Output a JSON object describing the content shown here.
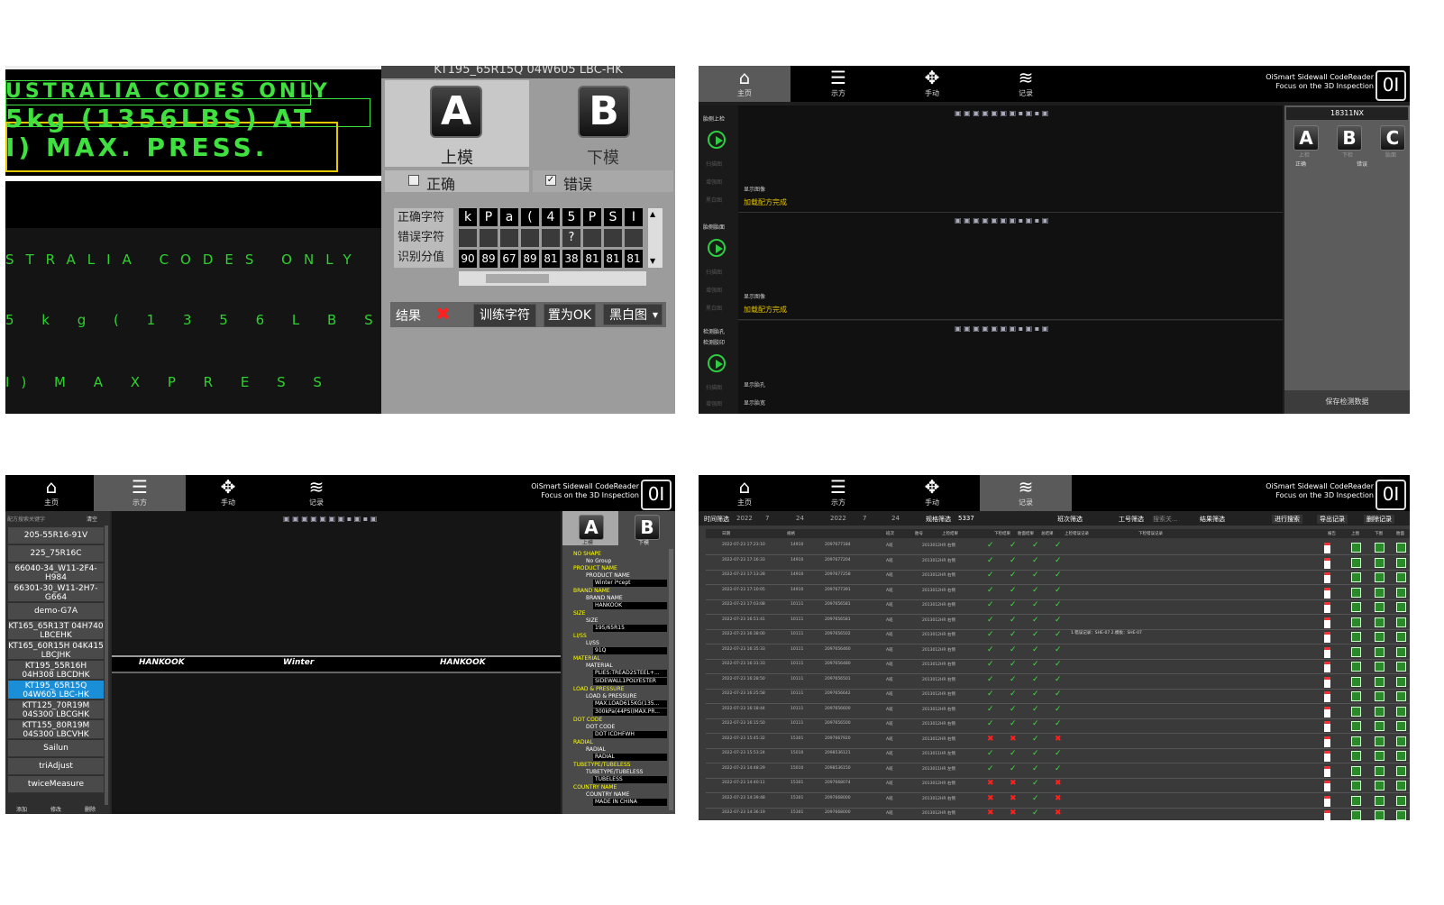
{
  "panel1": {
    "ocr_top_lines": [
      "USTRALIA CODES ONLY",
      "5kg (1356LBS) AT",
      "I) MAX. PRESS."
    ],
    "ocr_spaced_lines": [
      "STRALIA CODES ONLY",
      "5 k g ( 1 3 5 6 L B S ) A T",
      "I) M A X P R E S S"
    ],
    "mold_title": "KT195_65R15Q 04W605 LBC-HK",
    "upper_mold_key": "A",
    "upper_mold_label": "上模",
    "lower_mold_key": "B",
    "lower_mold_label": "下模",
    "correct_label": "正确",
    "wrong_label": "错误",
    "correct_checked": false,
    "wrong_checked": true,
    "row_correct_chars": "正确字符",
    "row_wrong_chars": "错误字符",
    "row_scores": "识别分值",
    "chars": [
      "k",
      "P",
      "a",
      "(",
      "4",
      "5",
      "P",
      "S",
      "I"
    ],
    "wrong_chars": [
      "",
      "",
      "",
      "",
      "",
      "?",
      "",
      "",
      ""
    ],
    "scores": [
      "90",
      "89",
      "67",
      "89",
      "81",
      "38",
      "81",
      "81",
      "81"
    ],
    "result_label": "结果",
    "result_icon": "x-icon",
    "train_button": "训练字符",
    "set_ok_button": "置为OK",
    "view_select": "黑白图"
  },
  "nav": {
    "home": "主页",
    "teach": "示方",
    "manual": "手动",
    "record": "记录"
  },
  "brand": {
    "name": "OiSmart Sidewall CodeReader",
    "slogan": "Focus on the 3D Inspection",
    "logo": "0I"
  },
  "panel2": {
    "side_labels_1": [
      "胎侧上检",
      "扫描图",
      "增强图",
      "黑白图"
    ],
    "side_labels_2": [
      "胎侧胎面",
      "扫描图",
      "增强图",
      "黑白图"
    ],
    "side_labels_3": [
      "检测胎孔",
      "检测胶印",
      "扫描图",
      "增强图"
    ],
    "show_img_labels": [
      "显示图像",
      "显示图像",
      "显示胎孔",
      "显示胎宽"
    ],
    "load_done": [
      "加载配方完成",
      "加载配方完成"
    ],
    "recipe_id": "18311NX",
    "keys": [
      "A",
      "B",
      "C"
    ],
    "key_labels": [
      "上检",
      "下检",
      "胎面"
    ],
    "right_checks": [
      "正确",
      "错误"
    ],
    "save_button": "保存检测数据"
  },
  "panel3": {
    "search_placeholder": "配方搜索关键字",
    "clear_label": "清空",
    "recipes": [
      "205-55R16-91V",
      "225_75R16C",
      "66040-34_W11-2F4-H984",
      "66301-30_W11-2H7-G664",
      "demo-G7A",
      "KT165_65R13T 04H740 LBCEHK",
      "KT165_60R15H 04K415 LBCJHK",
      "KT195_55R16H 04H308 LBCDHK",
      "KT195_65R15Q 04W605 LBC-HK",
      "KTT125_70R19M 04S300 LBCGHK",
      "KTT155_80R19M 04S300 LBCVHK",
      "Sailun",
      "triAdjust",
      "twiceMeasure"
    ],
    "selected_index": 8,
    "bottom_buttons": [
      "添加",
      "修改",
      "删除"
    ],
    "tread_texts": [
      "HANKOOK",
      "Winter",
      "HANKOOK"
    ],
    "keys": [
      "A",
      "B"
    ],
    "key_labels": [
      "上模",
      "下模"
    ],
    "tree": [
      {
        "group": "NO SHAPE",
        "item": "No Group",
        "value": ""
      },
      {
        "group": "PRODUCT NAME",
        "item": "PRODUCT NAME",
        "value": "Winter i*cept"
      },
      {
        "group": "BRAND NAME",
        "item": "BRAND NAME",
        "value": "HANKOOK"
      },
      {
        "group": "SIZE",
        "item": "SIZE",
        "value": "195/65R15"
      },
      {
        "group": "LI/SS",
        "item": "LI/SS",
        "value": "91Q"
      },
      {
        "group": "MATERIAL",
        "item": "MATERIAL",
        "value": "PLIES:TREAD2STEEL+..."
      },
      {
        "group": "",
        "item": "",
        "value": "SIDEWALL1POLYESTER"
      },
      {
        "group": "LOAD & PRESSURE",
        "item": "LOAD & PRESSURE",
        "value": "MAX.LOAD615KG(135..."
      },
      {
        "group": "",
        "item": "",
        "value": "300kPa(44PSI)MAX.PR..."
      },
      {
        "group": "DOT CODE",
        "item": "DOT CODE",
        "value": "DOT ICDHFWH"
      },
      {
        "group": "RADIAL",
        "item": "RADIAL",
        "value": "RADIAL"
      },
      {
        "group": "TUBETYPE/TUBELESS",
        "item": "TUBETYPE/TUBELESS",
        "value": "TUBELESS"
      },
      {
        "group": "COUNTRY NAME",
        "item": "COUNTRY NAME",
        "value": "MADE IN CHINA"
      }
    ]
  },
  "panel4": {
    "time_filter": "时间筛选",
    "date_from": "2022",
    "date_to": "2022",
    "month_from": "7",
    "day_from": "24",
    "month_to": "7",
    "day_to": "24",
    "spec_filter": "规格筛选",
    "spec_value": "5337",
    "shift_filter": "班次筛选",
    "worker_filter": "工号筛选",
    "worker_placeholder": "搜索关...",
    "result_filter": "结果筛选",
    "search_button": "进行搜索",
    "export_button": "导出记录",
    "delete_button": "删除记录",
    "columns": [
      "日期",
      "规格",
      "班次",
      "胎号",
      "上检结果",
      "下检结果",
      "胎面结果",
      "总结果",
      "上检错误记录",
      "下检错误记录",
      "报告",
      "上图",
      "下图",
      "胎面"
    ],
    "rows": [
      {
        "date": "2022-07-23 17:23:10",
        "spec": "14910",
        "no": "2097677184",
        "shift": "A班",
        "code": "2013012HR 右侧",
        "r": [
          "ok",
          "ok",
          "ok",
          "ok"
        ],
        "note": ""
      },
      {
        "date": "2022-07-23 17:16:33",
        "spec": "14910",
        "no": "2097677204",
        "shift": "A班",
        "code": "2013012HR 右侧",
        "r": [
          "ok",
          "ok",
          "ok",
          "ok"
        ],
        "note": ""
      },
      {
        "date": "2022-07-23 17:13:28",
        "spec": "14910",
        "no": "2097677258",
        "shift": "A班",
        "code": "2013012HR 右侧",
        "r": [
          "ok",
          "ok",
          "ok",
          "ok"
        ],
        "note": ""
      },
      {
        "date": "2022-07-23 17:10:05",
        "spec": "14910",
        "no": "2097677391",
        "shift": "A班",
        "code": "2013012HR 右侧",
        "r": [
          "ok",
          "ok",
          "ok",
          "ok"
        ],
        "note": ""
      },
      {
        "date": "2022-07-23 17:03:08",
        "spec": "10111",
        "no": "2097656581",
        "shift": "A班",
        "code": "2013012HR 右侧",
        "r": [
          "ok",
          "ok",
          "ok",
          "ok"
        ],
        "note": ""
      },
      {
        "date": "2022-07-23 16:51:41",
        "spec": "10111",
        "no": "2097656581",
        "shift": "A班",
        "code": "2013012HR 右侧",
        "r": [
          "ok",
          "ok",
          "ok",
          "ok"
        ],
        "note": ""
      },
      {
        "date": "2022-07-23 16:38:00",
        "spec": "10111",
        "no": "2097656502",
        "shift": "A班",
        "code": "2013012HR 右侧",
        "r": [
          "ok",
          "ok",
          "ok",
          "ok"
        ],
        "note": "1.错误记录：SHE-07 2.模板：SHE-07"
      },
      {
        "date": "2022-07-23 16:35:33",
        "spec": "10111",
        "no": "2097656460",
        "shift": "A班",
        "code": "2013012HR 右侧",
        "r": [
          "ok",
          "ok",
          "ok",
          "ok"
        ],
        "note": ""
      },
      {
        "date": "2022-07-23 16:31:33",
        "spec": "10111",
        "no": "2097656480",
        "shift": "A班",
        "code": "2013012HR 右侧",
        "r": [
          "ok",
          "ok",
          "ok",
          "ok"
        ],
        "note": ""
      },
      {
        "date": "2022-07-23 16:28:50",
        "spec": "10111",
        "no": "2097656501",
        "shift": "A班",
        "code": "2013012HR 右侧",
        "r": [
          "ok",
          "ok",
          "ok",
          "ok"
        ],
        "note": ""
      },
      {
        "date": "2022-07-23 16:25:58",
        "spec": "10111",
        "no": "2097656642",
        "shift": "A班",
        "code": "2013012HR 右侧",
        "r": [
          "ok",
          "ok",
          "ok",
          "ok"
        ],
        "note": ""
      },
      {
        "date": "2022-07-23 16:18:44",
        "spec": "10111",
        "no": "2097656600",
        "shift": "A班",
        "code": "2013012HR 右侧",
        "r": [
          "ok",
          "ok",
          "ok",
          "ok"
        ],
        "note": ""
      },
      {
        "date": "2022-07-23 16:15:50",
        "spec": "10111",
        "no": "2097656500",
        "shift": "A班",
        "code": "2013012HR 右侧",
        "r": [
          "ok",
          "ok",
          "ok",
          "ok"
        ],
        "note": ""
      },
      {
        "date": "2022-07-23 15:45:32",
        "spec": "15301",
        "no": "2097667920",
        "shift": "A班",
        "code": "2013012HR 右侧",
        "r": [
          "ng",
          "ng",
          "ok",
          "ng"
        ],
        "note": ""
      },
      {
        "date": "2022-07-23 15:53:24",
        "spec": "15010",
        "no": "2098536121",
        "shift": "A班",
        "code": "2013011HR 左侧",
        "r": [
          "ok",
          "ok",
          "ok",
          "ok"
        ],
        "note": ""
      },
      {
        "date": "2022-07-23 14:48:29",
        "spec": "15010",
        "no": "2098536150",
        "shift": "A班",
        "code": "2013011HR 左侧",
        "r": [
          "ok",
          "ok",
          "ok",
          "ok"
        ],
        "note": ""
      },
      {
        "date": "2022-07-23 14:40:11",
        "spec": "15301",
        "no": "2097668074",
        "shift": "A班",
        "code": "2013012HR 右侧",
        "r": [
          "ng",
          "ng",
          "ok",
          "ng"
        ],
        "note": ""
      },
      {
        "date": "2022-07-23 14:39:48",
        "spec": "15301",
        "no": "2097668000",
        "shift": "A班",
        "code": "2013012HR 右侧",
        "r": [
          "ng",
          "ng",
          "ok",
          "ng"
        ],
        "note": ""
      },
      {
        "date": "2022-07-23 14:36:19",
        "spec": "15301",
        "no": "2097668000",
        "shift": "A班",
        "code": "2013012HR 右侧",
        "r": [
          "ng",
          "ng",
          "ok",
          "ng"
        ],
        "note": ""
      }
    ]
  }
}
